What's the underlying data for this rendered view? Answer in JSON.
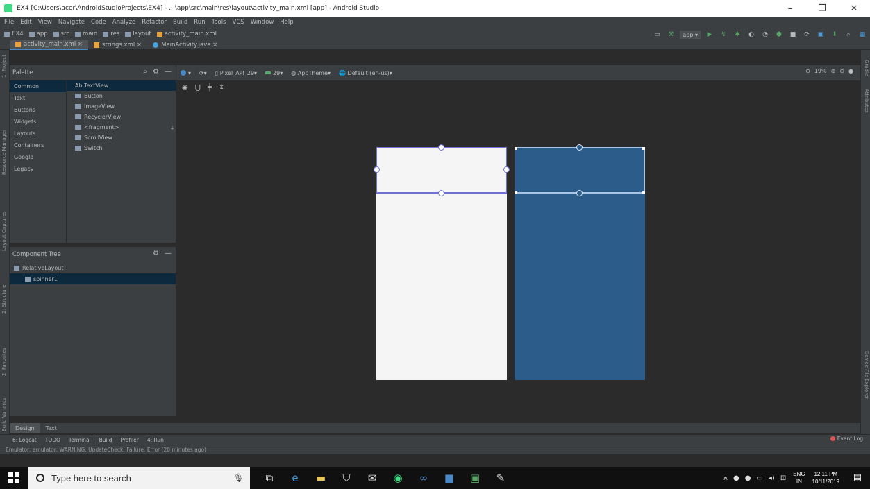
{
  "window": {
    "title": "EX4 [C:\\Users\\acer\\AndroidStudioProjects\\EX4] - ...\\app\\src\\main\\res\\layout\\activity_main.xml [app] - Android Studio",
    "minimize": "–",
    "maximize": "❐",
    "close": "✕"
  },
  "menu": [
    "File",
    "Edit",
    "View",
    "Navigate",
    "Code",
    "Analyze",
    "Refactor",
    "Build",
    "Run",
    "Tools",
    "VCS",
    "Window",
    "Help"
  ],
  "breadcrumbs": [
    "EX4",
    "app",
    "src",
    "main",
    "res",
    "layout",
    "activity_main.xml"
  ],
  "run_config": "app",
  "editor_tabs": [
    {
      "label": "activity_main.xml",
      "active": true
    },
    {
      "label": "strings.xml",
      "active": false
    },
    {
      "label": "MainActivity.java",
      "active": false
    }
  ],
  "left_stripe": [
    "1: Project",
    "Resource Manager",
    "Layout Captures",
    "2: Structure",
    "2: Favorites",
    "Build Variants"
  ],
  "right_stripe": [
    "Gradle",
    "Attributes",
    "Device File Explorer"
  ],
  "palette": {
    "title": "Palette",
    "categories": [
      "Common",
      "Text",
      "Buttons",
      "Widgets",
      "Layouts",
      "Containers",
      "Google",
      "Legacy"
    ],
    "widgets": [
      "Ab TextView",
      "Button",
      "ImageView",
      "RecyclerView",
      "<fragment>",
      "ScrollView",
      "Switch"
    ]
  },
  "component_tree": {
    "title": "Component Tree",
    "items": [
      "RelativeLayout",
      "spinner1"
    ]
  },
  "design_toolbar": {
    "device": "Pixel_API_29",
    "api": "29",
    "theme": "AppTheme",
    "locale": "Default (en-us)",
    "zoom": "19%"
  },
  "bottom_tabs": [
    "Design",
    "Text"
  ],
  "tool_windows": [
    "6: Logcat",
    "TODO",
    "Terminal",
    "Build",
    "Profiler",
    "4: Run"
  ],
  "event_log": "Event Log",
  "status_message": "Emulator: emulator: WARNING: UpdateCheck: Failure: Error (20 minutes ago)",
  "taskbar": {
    "search_placeholder": "Type here to search",
    "lang_line1": "ENG",
    "lang_line2": "IN",
    "time": "12:11 PM",
    "date": "10/11/2019"
  },
  "colors": {
    "ide_background": "#2b2b2b",
    "panel": "#3c3f41",
    "blueprint": "#2c5c8a",
    "selection": "#0d293e",
    "constraint": "#6f6fd8"
  }
}
